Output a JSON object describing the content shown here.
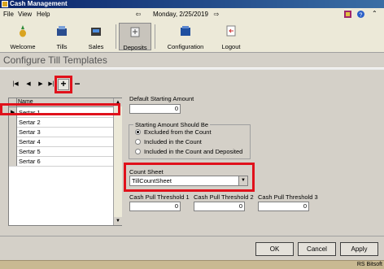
{
  "window": {
    "title": "Cash Management"
  },
  "menu": {
    "items": [
      "File",
      "View",
      "Help"
    ],
    "date_text": "Monday, 2/25/2019"
  },
  "toolbar": {
    "buttons": [
      {
        "label": "Welcome",
        "icon": "pineapple-icon"
      },
      {
        "label": "Tills",
        "icon": "till-icon"
      },
      {
        "label": "Sales",
        "icon": "register-icon"
      },
      {
        "label": "Deposits",
        "icon": "deposit-icon"
      },
      {
        "label": "Configuration",
        "icon": "config-icon"
      },
      {
        "label": "Logout",
        "icon": "logout-icon"
      }
    ]
  },
  "page": {
    "title": "Configure Till Templates"
  },
  "nav": {
    "first": "|◀",
    "prev": "◀",
    "next": "▶",
    "last": "▶|",
    "add": "+",
    "remove": "−"
  },
  "grid": {
    "header": "Name",
    "rows": [
      "Sertar 1",
      "Sertar 2",
      "Sertar 3",
      "Sertar 4",
      "Sertar 5",
      "Sertar 6"
    ]
  },
  "form": {
    "default_starting_amount_label": "Default Starting Amount",
    "default_starting_amount_value": "0",
    "starting_amount_group_label": "Starting Amount Should Be",
    "radio_options": [
      "Excluded from the Count",
      "Included in the Count",
      "Included in the Count and Deposited"
    ],
    "radio_selected": 0,
    "count_sheet_label": "Count Sheet",
    "count_sheet_value": "TillCountSheet",
    "thresholds": [
      {
        "label": "Cash Pull Threshold 1",
        "value": "0"
      },
      {
        "label": "Cash Pull Threshold 2",
        "value": "0"
      },
      {
        "label": "Cash Pull Threshold 3",
        "value": "0"
      }
    ]
  },
  "buttons": {
    "ok": "OK",
    "cancel": "Cancel",
    "apply": "Apply"
  },
  "status": {
    "text": "RS Bitsoft"
  },
  "colors": {
    "highlight": "#e0111b",
    "titlebar": "#0a246a"
  }
}
